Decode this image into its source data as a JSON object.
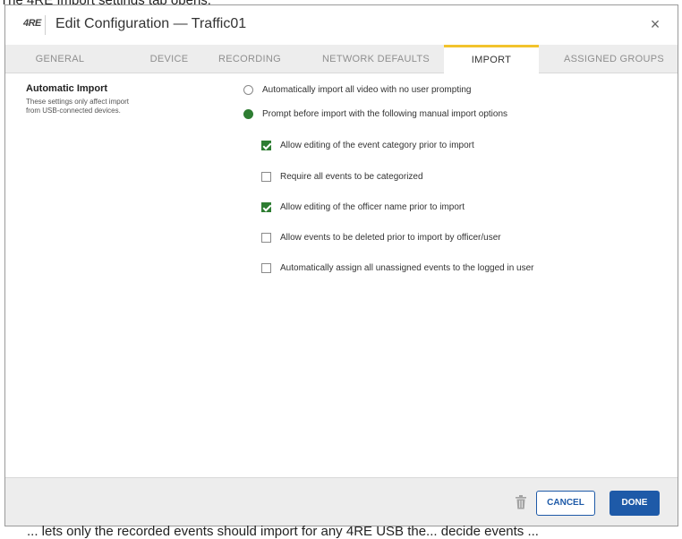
{
  "captions": {
    "top": "The 4RE Import settings tab opens.",
    "bottom": "... lets only the recorded events should import for any 4RE USB the... decide events ..."
  },
  "dialog": {
    "logo": "4RE",
    "title": "Edit Configuration — Traffic01",
    "close_glyph": "×"
  },
  "tabs": [
    {
      "label": "GENERAL"
    },
    {
      "label": "DEVICE"
    },
    {
      "label": "RECORDING"
    },
    {
      "label": "NETWORK DEFAULTS"
    },
    {
      "label": "IMPORT"
    },
    {
      "label": "ASSIGNED GROUPS"
    }
  ],
  "active_tab": "IMPORT",
  "section": {
    "title": "Automatic Import",
    "description": "These settings only affect import from USB-connected devices."
  },
  "radios": [
    {
      "label": "Automatically import all video with no user prompting",
      "selected": false
    },
    {
      "label": "Prompt before import with the following manual import options",
      "selected": true
    }
  ],
  "checkboxes": [
    {
      "label": "Allow editing of the event category prior to import",
      "checked": true
    },
    {
      "label": "Require all events to be categorized",
      "checked": false
    },
    {
      "label": "Allow editing of the officer name prior to import",
      "checked": true
    },
    {
      "label": "Allow events to be deleted prior to import by officer/user",
      "checked": false
    },
    {
      "label": "Automatically assign all unassigned events to the logged in user",
      "checked": false
    }
  ],
  "footer": {
    "delete_icon": "trash-icon",
    "cancel_label": "CANCEL",
    "done_label": "DONE"
  },
  "colors": {
    "accent_tab": "#f2c32c",
    "check_green": "#2e7d32",
    "primary_blue": "#1e5aa8"
  }
}
